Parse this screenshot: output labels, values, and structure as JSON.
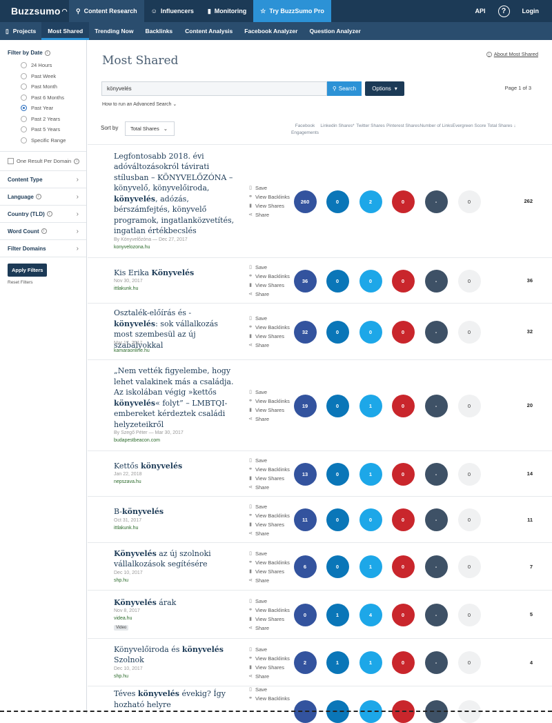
{
  "topbar": {
    "logo": "Buzzsumo",
    "nav": [
      "Content Research",
      "Influencers",
      "Monitoring",
      "Try BuzzSumo Pro"
    ],
    "api": "API",
    "help": "?",
    "login": "Login"
  },
  "subnav": [
    "Projects",
    "Most Shared",
    "Trending Now",
    "Backlinks",
    "Content Analysis",
    "Facebook Analyzer",
    "Question Analyzer"
  ],
  "sidebar": {
    "filter_date_title": "Filter by Date",
    "date_options": [
      "24 Hours",
      "Past Week",
      "Past Month",
      "Past 6 Months",
      "Past Year",
      "Past 2 Years",
      "Past 5 Years",
      "Specific Range"
    ],
    "selected_date": "Past Year",
    "one_result": "One Result Per Domain",
    "accordions": [
      "Content Type",
      "Language",
      "Country (TLD)",
      "Word Count",
      "Filter Domains"
    ],
    "apply": "Apply Filters",
    "reset": "Reset Filters"
  },
  "main": {
    "title": "Most Shared",
    "about": "About Most Shared",
    "search_value": "könyvelés",
    "search_btn": "Search",
    "options_btn": "Options",
    "page_info": "Page 1 of 3",
    "advanced": "How to run an Advanced Search",
    "sort_label": "Sort by",
    "sort_value": "Total Shares",
    "columns": [
      "Facebook Engagements",
      "Linkedin Shares*",
      "Twitter Shares",
      "Pinterest Shares",
      "Number of Links",
      "Evergreen Score",
      "Total Shares ↓"
    ]
  },
  "actions": [
    "Save",
    "View Backlinks",
    "View Shares",
    "Share"
  ],
  "results": [
    {
      "title_html": "Legfontosabb 2018. évi adóváltozásokról távirati stílusban – KÖNYVELŐZÓNA – könyvelő, könyvelőiroda, <b>könyvelés</b>, adózás, bérszámfejtés, könyvelő programok, ingatlanközvetítés, ingatlan értékbecslés",
      "meta": "By Könyvelőzóna — Dec 27, 2017",
      "domain": "konyvelozona.hu",
      "fb": "260",
      "li": "0",
      "tw": "2",
      "pi": "0",
      "nl": "-",
      "ev": "0",
      "total": "262"
    },
    {
      "title_html": "Kis Erika <b>Könyvelés</b>",
      "meta": "Nov 30, 2017",
      "domain": "ittlakunk.hu",
      "fb": "36",
      "li": "0",
      "tw": "0",
      "pi": "0",
      "nl": "-",
      "ev": "0",
      "total": "36"
    },
    {
      "title_html": "Osztalék-előírás és -<b>könyvelés</b>: sok vállalkozás most szembesül az új szabályokkal",
      "meta": "Mar 17, 2017",
      "domain": "kamaraonline.hu",
      "fb": "32",
      "li": "0",
      "tw": "0",
      "pi": "0",
      "nl": "-",
      "ev": "0",
      "total": "32"
    },
    {
      "title_html": "„Nem vették figyelembe, hogy lehet valakinek más a családja. Az iskolában végig »kettős <b>könyvelés</b>« folyt” – LMBTQI-embereket kérdeztek családi helyzeteikről",
      "meta": "By Szegő Péter — Mar 30, 2017",
      "domain": "budapestbeacon.com",
      "fb": "19",
      "li": "0",
      "tw": "1",
      "pi": "0",
      "nl": "-",
      "ev": "0",
      "total": "20"
    },
    {
      "title_html": "Kettős <b>könyvelés</b>",
      "meta": "Jan 22, 2018",
      "domain": "nepszava.hu",
      "fb": "13",
      "li": "0",
      "tw": "1",
      "pi": "0",
      "nl": "-",
      "ev": "0",
      "total": "14"
    },
    {
      "title_html": "B-<b>könyvelés</b>",
      "meta": "Oct 31, 2017",
      "domain": "ittlakunk.hu",
      "fb": "11",
      "li": "0",
      "tw": "0",
      "pi": "0",
      "nl": "-",
      "ev": "0",
      "total": "11"
    },
    {
      "title_html": "<b>Könyvelés</b> az új szolnoki vállalkozások segítésére",
      "meta": "Dec 10, 2017",
      "domain": "shp.hu",
      "fb": "6",
      "li": "0",
      "tw": "1",
      "pi": "0",
      "nl": "-",
      "ev": "0",
      "total": "7"
    },
    {
      "title_html": "<b>Könyvelés</b> árak",
      "meta": "Nov 8, 2017",
      "domain": "videa.hu",
      "tag": "Video",
      "fb": "0",
      "li": "1",
      "tw": "4",
      "pi": "0",
      "nl": "-",
      "ev": "0",
      "total": "5"
    },
    {
      "title_html": "Könyvelőiroda és <b>könyvelés</b> Szolnok",
      "meta": "Dec 10, 2017",
      "domain": "shp.hu",
      "fb": "2",
      "li": "1",
      "tw": "1",
      "pi": "0",
      "nl": "-",
      "ev": "0",
      "total": "4"
    },
    {
      "title_html": "Téves <b>könyvelés</b> évekig? Így hozható helyre",
      "meta": "",
      "domain": "",
      "fb": "",
      "li": "",
      "tw": "",
      "pi": "",
      "nl": "",
      "ev": "",
      "total": ""
    }
  ]
}
